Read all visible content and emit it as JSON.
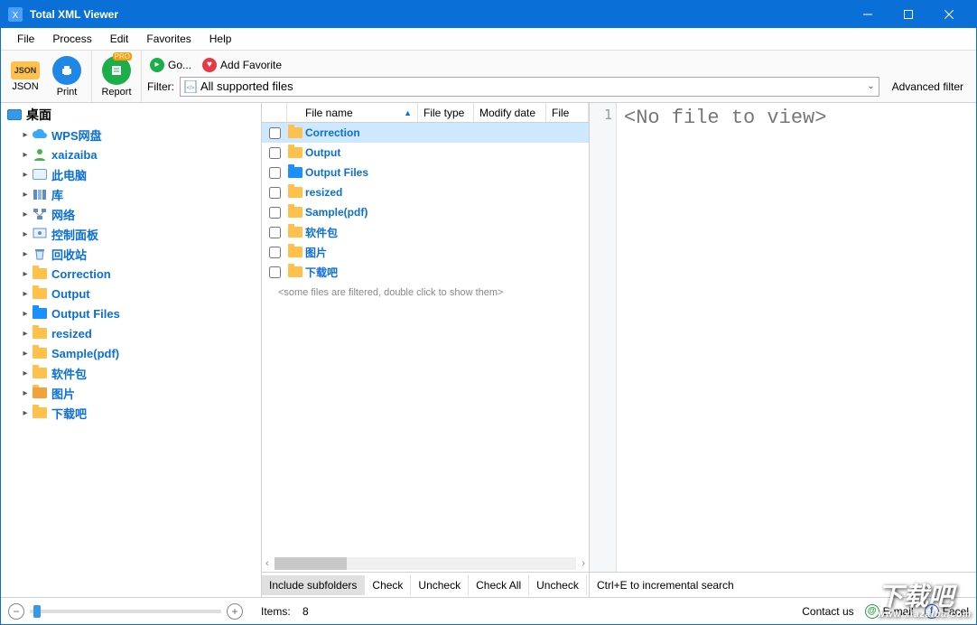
{
  "titlebar": {
    "title": "Total XML Viewer"
  },
  "menubar": {
    "items": [
      "File",
      "Process",
      "Edit",
      "Favorites",
      "Help"
    ]
  },
  "toolbar": {
    "json_label": "JSON",
    "print_label": "Print",
    "report_label": "Report",
    "go_label": "Go...",
    "add_fav_label": "Add Favorite",
    "filter_label": "Filter:",
    "filter_value": "All supported files",
    "advanced_filter": "Advanced filter",
    "pro_badge": "PRO"
  },
  "tree": {
    "root": {
      "label": "桌面"
    },
    "items": [
      {
        "label": "WPS网盘",
        "icon": "cloud"
      },
      {
        "label": "xaizaiba",
        "icon": "user"
      },
      {
        "label": "此电脑",
        "icon": "monitor"
      },
      {
        "label": "库",
        "icon": "libraries"
      },
      {
        "label": "网络",
        "icon": "network"
      },
      {
        "label": "控制面板",
        "icon": "control"
      },
      {
        "label": "回收站",
        "icon": "recycle"
      },
      {
        "label": "Correction",
        "icon": "folder"
      },
      {
        "label": "Output",
        "icon": "folder"
      },
      {
        "label": "Output Files",
        "icon": "folder-blue"
      },
      {
        "label": "resized",
        "icon": "folder"
      },
      {
        "label": "Sample(pdf)",
        "icon": "folder"
      },
      {
        "label": "软件包",
        "icon": "folder"
      },
      {
        "label": "图片",
        "icon": "folder-pic"
      },
      {
        "label": "下载吧",
        "icon": "folder"
      }
    ]
  },
  "columns": {
    "name": "File name",
    "type": "File type",
    "date": "Modify date",
    "size": "File"
  },
  "files": [
    {
      "name": "Correction",
      "selected": true
    },
    {
      "name": "Output"
    },
    {
      "name": "Output Files",
      "blue": true
    },
    {
      "name": "resized"
    },
    {
      "name": "Sample(pdf)"
    },
    {
      "name": "软件包"
    },
    {
      "name": "图片"
    },
    {
      "name": "下载吧"
    }
  ],
  "filter_msg": "<some files are filtered, double click to show them>",
  "bottom_buttons": {
    "include": "Include subfolders",
    "check": "Check",
    "uncheck": "Uncheck",
    "check_all": "Check All",
    "uncheck_all": "Uncheck"
  },
  "preview": {
    "line_no": "1",
    "text": "<No file to view>",
    "footer": "Ctrl+E to incremental search"
  },
  "status": {
    "items_label": "Items:",
    "items_count": "8",
    "contact": "Contact us",
    "email": "E-mail",
    "facebook": "Facel"
  },
  "watermark": {
    "main": "下载吧",
    "sub": "www.xiazaiba.com"
  }
}
